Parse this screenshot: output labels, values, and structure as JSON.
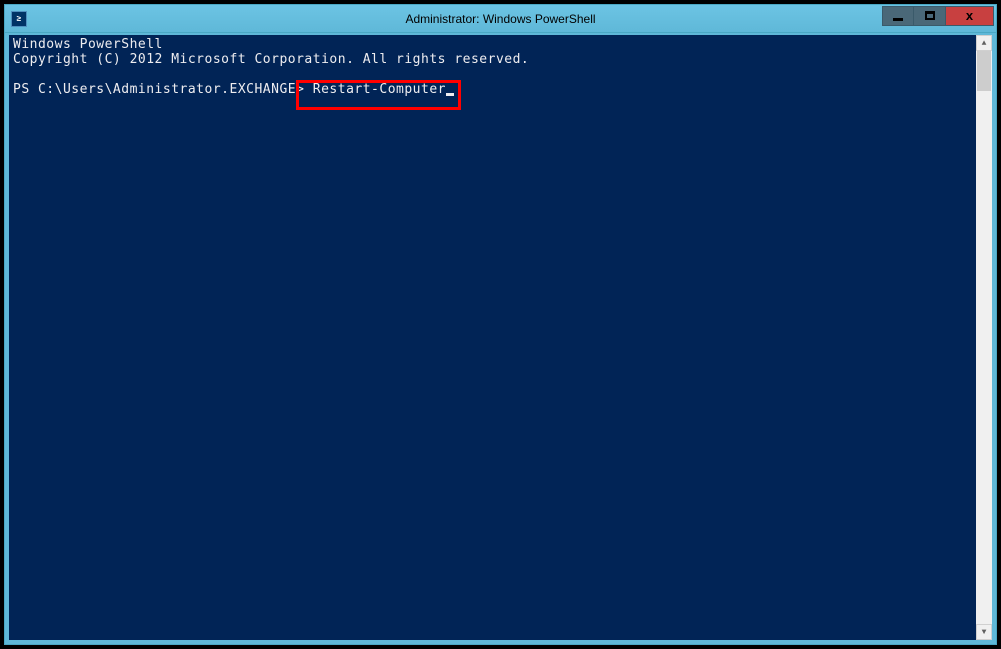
{
  "window": {
    "title": "Administrator: Windows PowerShell"
  },
  "console": {
    "header_line1": "Windows PowerShell",
    "header_line2": "Copyright (C) 2012 Microsoft Corporation. All rights reserved.",
    "prompt": "PS C:\\Users\\Administrator.EXCHANGE>",
    "command": "Restart-Computer"
  },
  "controls": {
    "minimize": "_",
    "maximize": "□",
    "close": "x"
  }
}
